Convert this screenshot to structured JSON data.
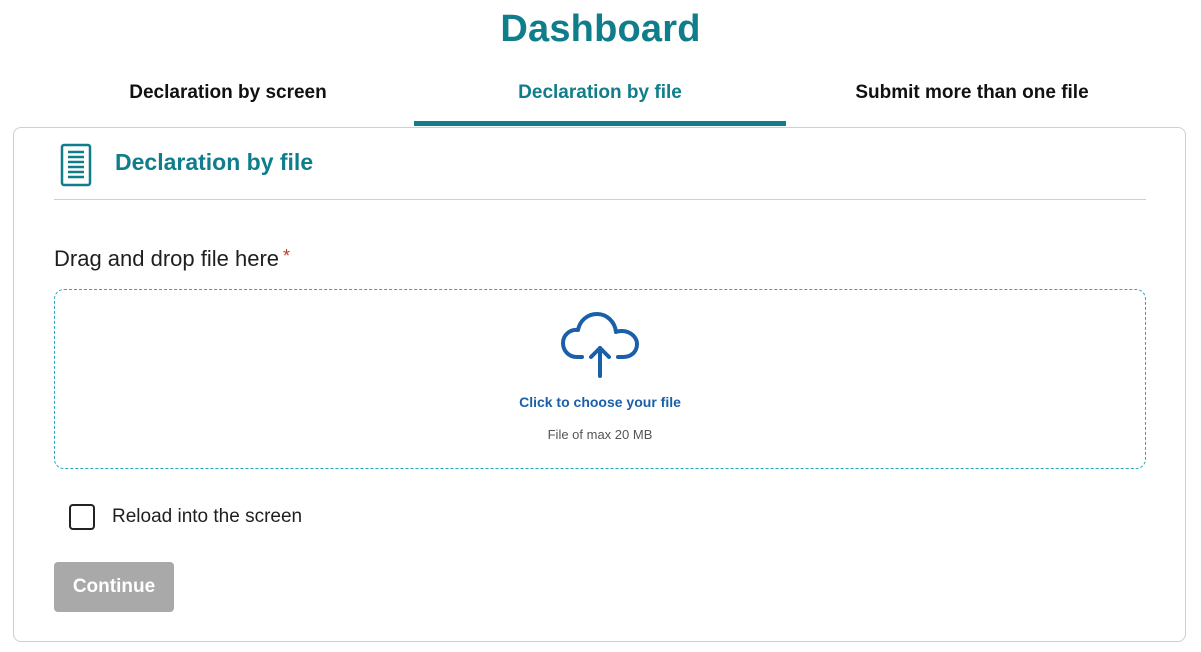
{
  "page": {
    "title": "Dashboard"
  },
  "tabs": [
    {
      "label": "Declaration by screen",
      "active": false
    },
    {
      "label": "Declaration by file",
      "active": true
    },
    {
      "label": "Submit more than one file",
      "active": false
    }
  ],
  "card": {
    "icon": "document-icon",
    "title": "Declaration by file",
    "drop_label": "Drag and drop file here",
    "required_marker": "*",
    "dropzone": {
      "icon": "cloud-upload-icon",
      "link_text": "Click to choose your file",
      "hint": "File of max 20 MB"
    },
    "checkbox": {
      "label": "Reload into the screen",
      "checked": false
    },
    "continue_label": "Continue"
  },
  "colors": {
    "accent": "#0f7d8a",
    "link": "#1a5fa8",
    "dropzone_border": "#2aa9b8",
    "required": "#c0392b",
    "button_disabled": "#a9a9a9"
  }
}
